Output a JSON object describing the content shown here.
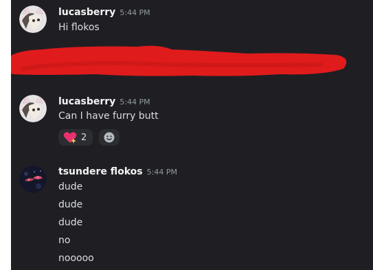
{
  "messages": [
    {
      "username": "lucasberry",
      "timestamp": "5:44 PM",
      "lines": [
        "Hi flokos"
      ],
      "avatar_icon": "cat-avatar-icon"
    },
    {
      "username": "lucasberry",
      "timestamp": "5:44 PM",
      "lines": [
        "Can I have furry butt"
      ],
      "avatar_icon": "cat-avatar-icon",
      "reactions": [
        {
          "icon": "sparkling-heart-icon",
          "count": "2"
        }
      ],
      "add_reaction_icon": "smiley-icon"
    },
    {
      "username": "tsundere flokos",
      "timestamp": "5:44 PM",
      "lines": [
        "dude",
        "dude",
        "dude",
        "no",
        "nooooo"
      ],
      "avatar_icon": "dark-floral-avatar-icon"
    }
  ],
  "colors": {
    "background": "#1f1f23",
    "username": "#f2f3f5",
    "text": "#dbdee1",
    "timestamp": "#949ba4",
    "redaction": "#e01b1b"
  }
}
